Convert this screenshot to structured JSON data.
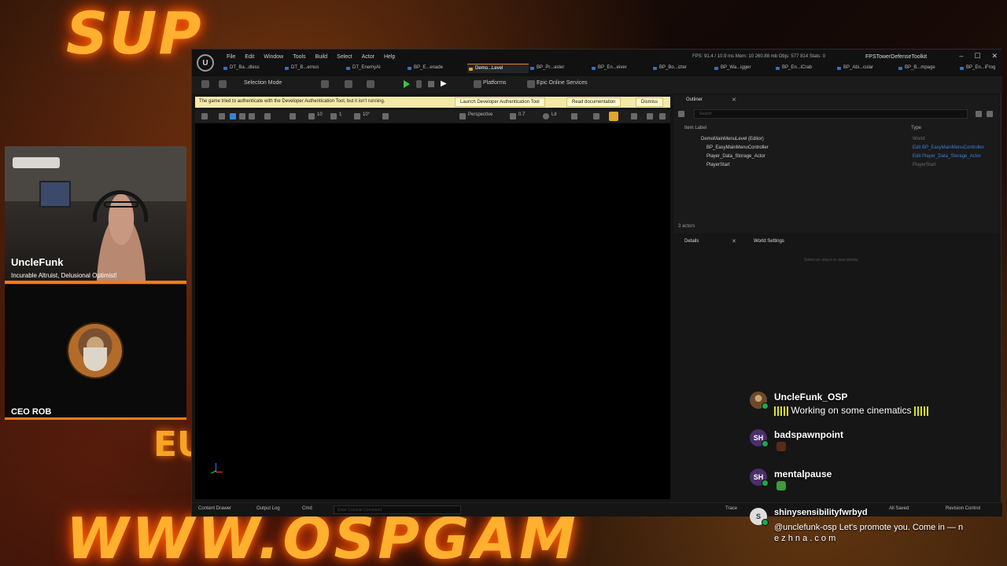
{
  "overlay": {
    "logo_text": "SUP",
    "url_text": "WWW.OSPGAM",
    "side_text": "EU"
  },
  "webcams": {
    "main": {
      "name": "UncleFunk",
      "tagline": "Incurable Altruist, Delusional Optimist!"
    },
    "second": {
      "name": "CEO ROB"
    }
  },
  "editor": {
    "logo": "U",
    "menu": [
      "File",
      "Edit",
      "Window",
      "Tools",
      "Build",
      "Select",
      "Actor",
      "Help"
    ],
    "stats": "FPS: 91.4 / 10.9 ms   Mem: 10 260.88 mb   Objs: 577 814   Stats: 0",
    "project": "FPSTowerDefenseToolkit",
    "window_controls": [
      "–",
      "☐",
      "✕"
    ],
    "tabs": [
      "DT_Ba...dless",
      "DT_B...ernus",
      "DT_EnemyAI",
      "BP_E...enade",
      "Demo...Level",
      "BP_Pr...aster",
      "BP_En...eiver",
      "BP_Bo...izter",
      "BP_Wa...igger",
      "BP_En...iCrab",
      "BP_Abi...cular",
      "BP_B...mpage",
      "BP_En...iFrog"
    ],
    "active_tab": 4,
    "toolbar": {
      "selection_mode": "Selection Mode",
      "platforms": "Platforms",
      "online_services": "Epic Online Services"
    },
    "notification": {
      "message": "The game tried to authenticate with the Developer Authentication Tool, but it isn't running.",
      "launch_button": "Launch Developer Authentication Tool",
      "docs_button": "Read documentation",
      "dismiss_button": "Dismiss"
    },
    "viewport_toolbar": {
      "grid_snap": "10",
      "rot_snap": "1",
      "scale_snap": "10°",
      "perspective": "Perspective",
      "speed": "0.7",
      "lit": "Lit"
    },
    "outliner": {
      "tab_label": "Outliner",
      "search_placeholder": "Search",
      "col_label": "Item Label",
      "col_type": "Type",
      "rows": [
        {
          "name": "DemoMainMenuLevel (Editor)",
          "type": "World",
          "link": false
        },
        {
          "name": "BP_EasyMainMenuController",
          "type": "Edit BP_EasyMainMenuController",
          "link": true
        },
        {
          "name": "Player_Data_Storage_Actor",
          "type": "Edit Player_Data_Storage_Actor",
          "link": true
        },
        {
          "name": "PlayerStart",
          "type": "PlayerStart",
          "link": false
        }
      ],
      "actor_count": "3 actors"
    },
    "details": {
      "tab_label": "Details",
      "world_settings_label": "World Settings",
      "hint": "Select an object to view details."
    },
    "statusbar": {
      "content_drawer": "Content Drawer",
      "output_log": "Output Log",
      "cmd": "Cmd",
      "console_placeholder": "Enter Console Command",
      "trace": "Trace",
      "all_saved": "All Saved",
      "revision_control": "Revision Control"
    }
  },
  "chat": [
    {
      "user": "UncleFunk_OSP",
      "text": "Working on some cinematics",
      "avatar": "",
      "emotes": true
    },
    {
      "user": "badspawnpoint",
      "text": "",
      "avatar": "SH",
      "emotes": false
    },
    {
      "user": "mentalpause",
      "text": "",
      "avatar": "SH",
      "emotes": false
    },
    {
      "user": "shinysensibilityfwrbyd",
      "text": "@unclefunk-osp Let's promote you. Come in — n",
      "text2": "e z h n a . c o m",
      "avatar": "S"
    }
  ]
}
